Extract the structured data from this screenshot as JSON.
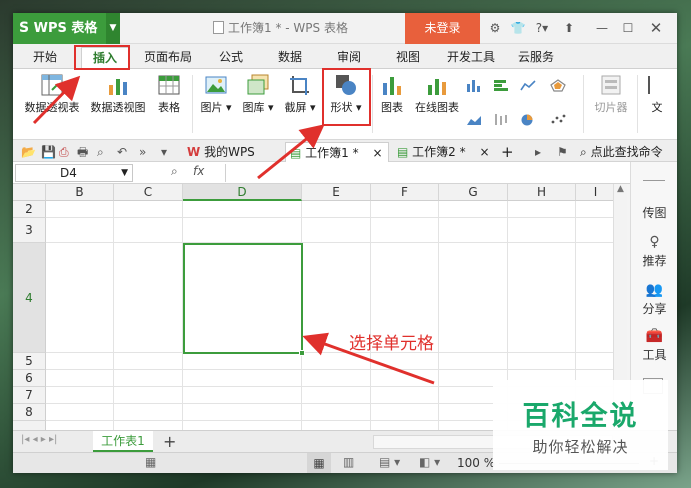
{
  "app": {
    "name": "WPS 表格",
    "doc_title": "工作簿1 * - WPS 表格",
    "login_label": "未登录",
    "help_label": "?"
  },
  "menu_tabs": [
    "开始",
    "插入",
    "页面布局",
    "公式",
    "数据",
    "审阅",
    "视图",
    "开发工具",
    "云服务"
  ],
  "active_tab": "插入",
  "ribbon": {
    "pivot_table": "数据透视表",
    "pivot_chart": "数据透视图",
    "table": "表格",
    "picture": "图片",
    "gallery": "图库",
    "screenshot": "截屏",
    "shapes": "形状",
    "chart": "图表",
    "online_chart": "在线图表",
    "slicer": "切片器",
    "text_box": "文"
  },
  "doc_tabs": {
    "my_wps": "我的WPS",
    "book1": "工作簿1 *",
    "book2": "工作簿2 *",
    "search": "点此查找命令"
  },
  "formula_bar": {
    "cell_ref": "D4",
    "fx": "fx"
  },
  "columns": [
    "B",
    "C",
    "D",
    "E",
    "F",
    "G",
    "H",
    "I"
  ],
  "rows": [
    "2",
    "3",
    "4",
    "5",
    "6",
    "7",
    "8"
  ],
  "selected_cell": "D4",
  "side_panel": {
    "item1": "传图",
    "item2": "推荐",
    "item3": "分享",
    "item4": "工具"
  },
  "sheet_tab": "工作表1",
  "status": {
    "zoom": "100 %"
  },
  "annotation": {
    "text": "选择单元格"
  },
  "watermark": {
    "title": "百科全说",
    "subtitle": "助你轻松解决"
  },
  "colors": {
    "accent_green": "#3c9c3c",
    "annotation_red": "#e0302c",
    "login_orange": "#e8603c",
    "watermark_green": "#1aa86b"
  }
}
